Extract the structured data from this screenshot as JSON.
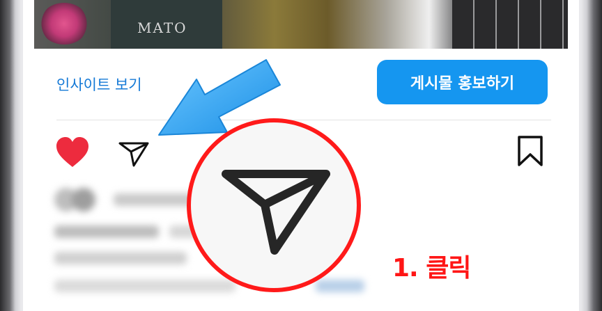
{
  "post": {
    "insights_label": "인사이트 보기",
    "promote_label": "게시물 홍보하기"
  },
  "icons": {
    "like": "heart-icon",
    "share": "paper-plane-icon",
    "save": "bookmark-icon"
  },
  "annotation": {
    "step_label": "1. 클릭"
  },
  "colors": {
    "link_blue": "#1479d6",
    "button_blue": "#1596f0",
    "heart_red": "#ed2b3e",
    "highlight_red": "#ff1a1a",
    "arrow_blue": "#3aa8f2"
  }
}
